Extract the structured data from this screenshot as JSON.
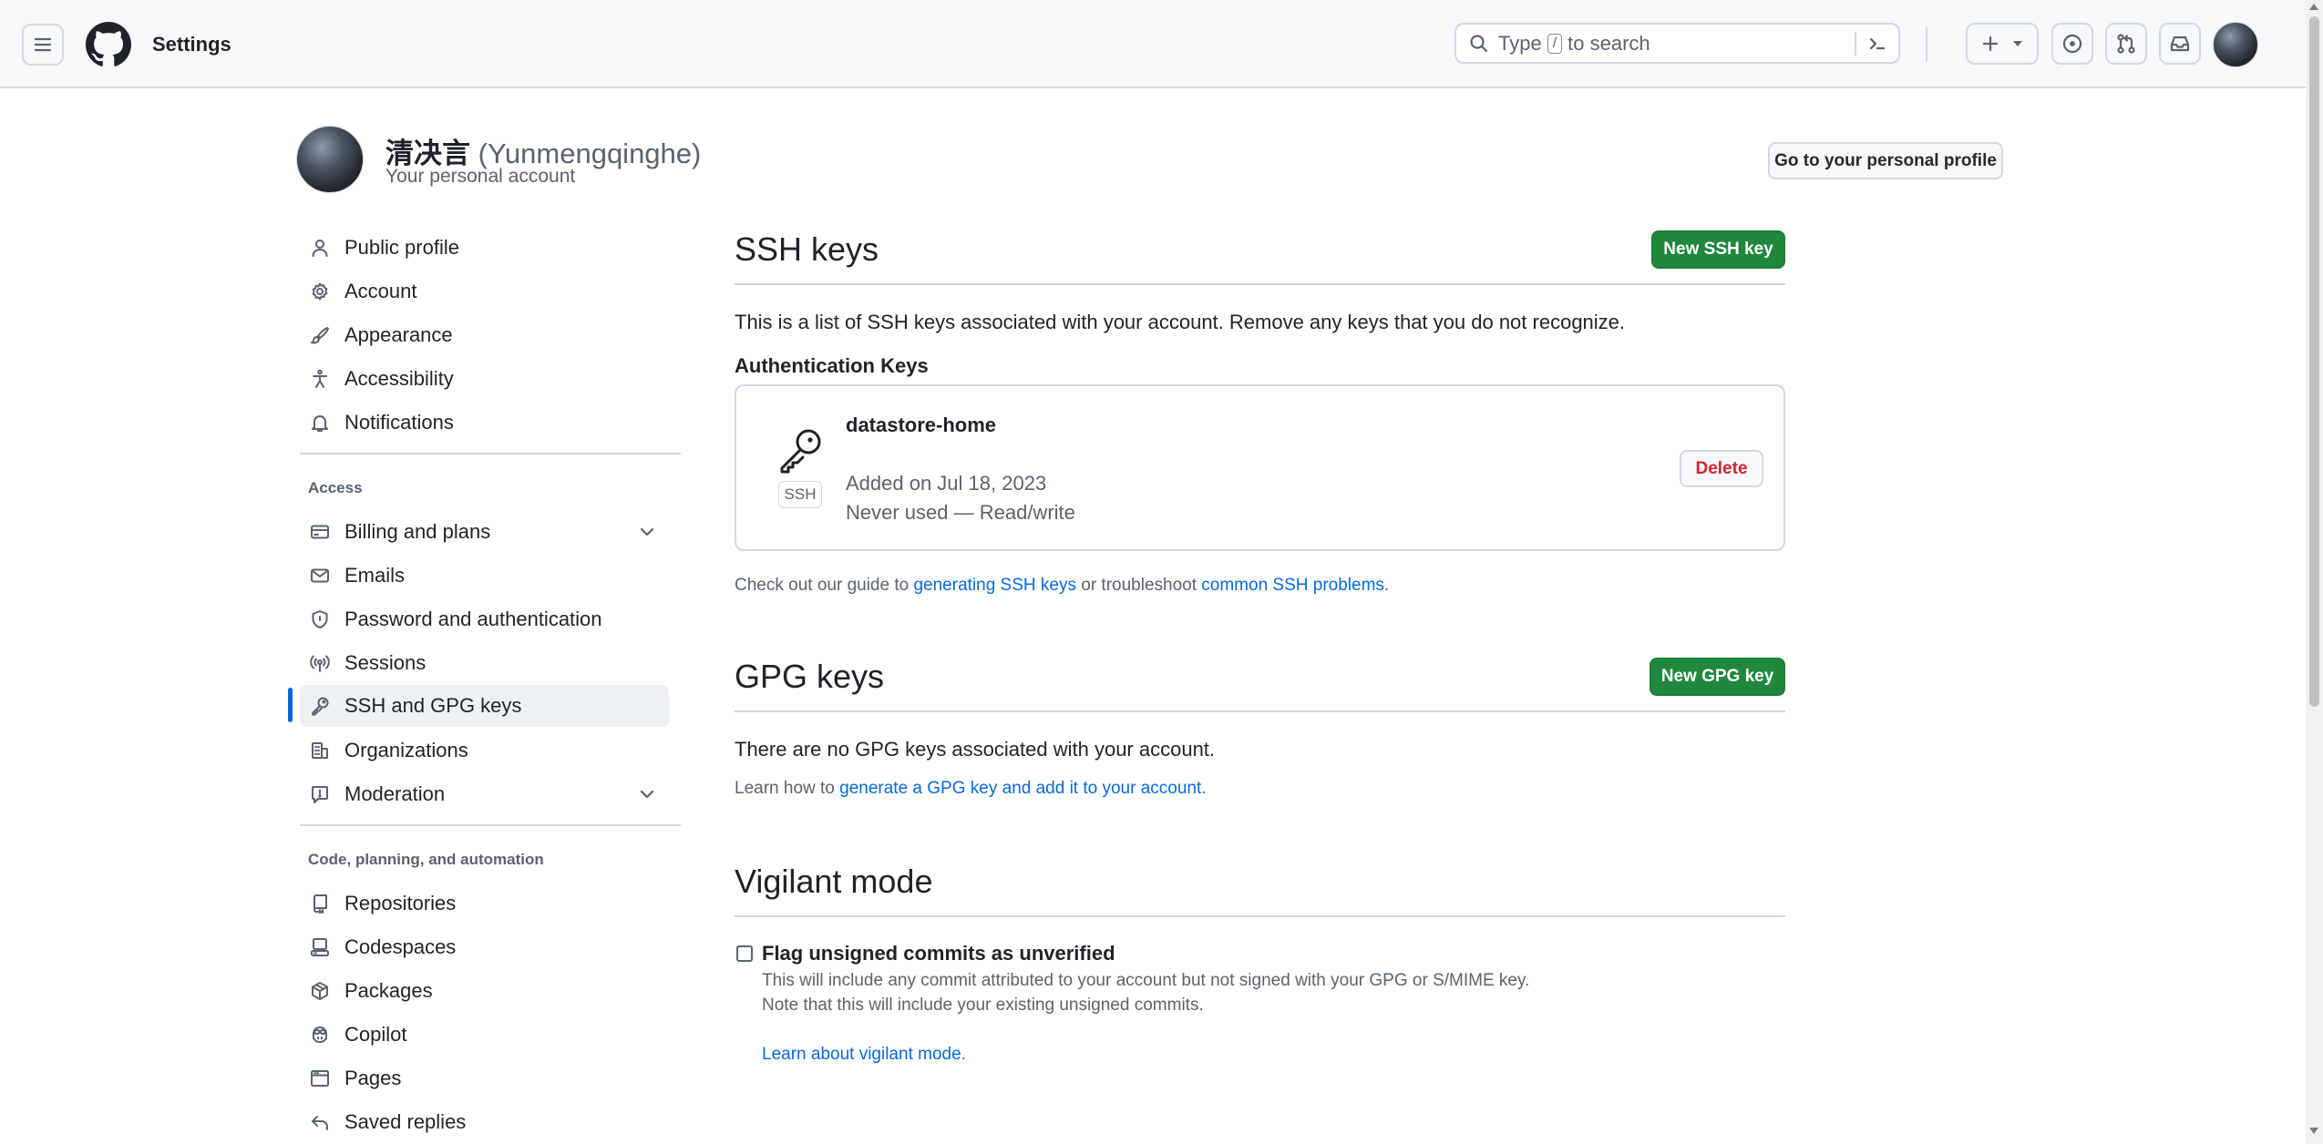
{
  "header": {
    "title": "Settings",
    "search": {
      "prefix": "Type",
      "key": "/",
      "suffix": "to search"
    },
    "create_label": "+"
  },
  "profile": {
    "name": "清决言",
    "login": "(Yunmengqinghe)",
    "subtitle": "Your personal account",
    "profile_button": "Go to your personal profile"
  },
  "sidebar": {
    "items_top": [
      {
        "label": "Public profile",
        "icon": "person-icon"
      },
      {
        "label": "Account",
        "icon": "gear-icon"
      },
      {
        "label": "Appearance",
        "icon": "paintbrush-icon"
      },
      {
        "label": "Accessibility",
        "icon": "accessibility-icon"
      },
      {
        "label": "Notifications",
        "icon": "bell-icon"
      }
    ],
    "access_label": "Access",
    "items_access": [
      {
        "label": "Billing and plans",
        "icon": "credit-card-icon",
        "expandable": true
      },
      {
        "label": "Emails",
        "icon": "mail-icon"
      },
      {
        "label": "Password and authentication",
        "icon": "shield-icon"
      },
      {
        "label": "Sessions",
        "icon": "broadcast-icon"
      },
      {
        "label": "SSH and GPG keys",
        "icon": "key-icon",
        "active": true
      },
      {
        "label": "Organizations",
        "icon": "organization-icon"
      },
      {
        "label": "Moderation",
        "icon": "report-icon",
        "expandable": true
      }
    ],
    "code_label": "Code, planning, and automation",
    "items_code": [
      {
        "label": "Repositories",
        "icon": "repo-icon"
      },
      {
        "label": "Codespaces",
        "icon": "codespaces-icon"
      },
      {
        "label": "Packages",
        "icon": "package-icon"
      },
      {
        "label": "Copilot",
        "icon": "copilot-icon"
      },
      {
        "label": "Pages",
        "icon": "browser-icon"
      },
      {
        "label": "Saved replies",
        "icon": "reply-icon"
      }
    ]
  },
  "ssh": {
    "title": "SSH keys",
    "new_button": "New SSH key",
    "description": "This is a list of SSH keys associated with your account. Remove any keys that you do not recognize.",
    "auth_heading": "Authentication Keys",
    "key": {
      "name": "datastore-home",
      "badge": "SSH",
      "added": "Added on Jul 18, 2023",
      "usage": "Never used — Read/write",
      "delete_label": "Delete"
    },
    "guide_prefix": "Check out our guide to",
    "guide_link1": "generating SSH keys",
    "guide_middle": "or troubleshoot",
    "guide_link2": "common SSH problems",
    "guide_suffix": "."
  },
  "gpg": {
    "title": "GPG keys",
    "new_button": "New GPG key",
    "empty_text": "There are no GPG keys associated with your account.",
    "learn_prefix": "Learn how to",
    "learn_link": "generate a GPG key and add it to your account",
    "learn_suffix": "."
  },
  "vigilant": {
    "title": "Vigilant mode",
    "checkbox_label": "Flag unsigned commits as unverified",
    "checked": false,
    "desc_line1": "This will include any commit attributed to your account but not signed with your GPG or S/MIME key.",
    "desc_line2": "Note that this will include your existing unsigned commits.",
    "learn_link": "Learn about vigilant mode."
  },
  "colors": {
    "primary_green": "#1f883d",
    "link_blue": "#0969da",
    "danger_red": "#d1242f",
    "active_marker": "#0969da"
  }
}
